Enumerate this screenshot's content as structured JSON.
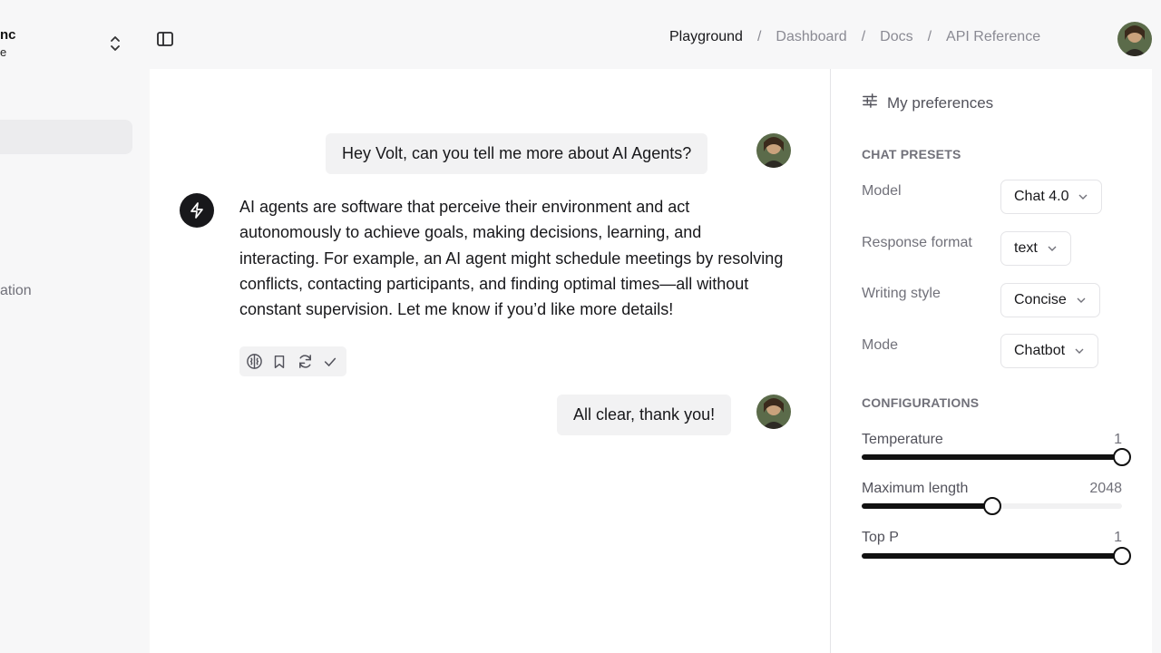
{
  "sidebar": {
    "org_name": "nc",
    "org_sub": "e",
    "items": [
      {
        "label": ""
      },
      {
        "label": "ation"
      }
    ]
  },
  "header": {
    "breadcrumb": [
      "Playground",
      "Dashboard",
      "Docs",
      "API Reference"
    ],
    "separator": "/"
  },
  "chat": {
    "messages": [
      {
        "role": "user",
        "text": "Hey Volt, can you tell me more about AI Agents?"
      },
      {
        "role": "assistant",
        "text": "AI agents are software that perceive their environment and act autonomously to achieve goals, making decisions, learning, and interacting. For example, an AI agent might schedule meetings by resolving conflicts, contacting participants, and finding optimal times—all without constant supervision. Let me know if you’d like more details!"
      },
      {
        "role": "user",
        "text": "All clear, thank you!"
      }
    ],
    "actions": [
      "brain-icon",
      "bookmark-icon",
      "refresh-icon",
      "check-icon"
    ]
  },
  "preferences": {
    "title": "My preferences",
    "presets_label": "CHAT PRESETS",
    "presets": [
      {
        "label": "Model",
        "value": "Chat 4.0"
      },
      {
        "label": "Response format",
        "value": "text"
      },
      {
        "label": "Writing style",
        "value": "Concise"
      },
      {
        "label": "Mode",
        "value": "Chatbot"
      }
    ],
    "config_label": "CONFIGURATIONS",
    "sliders": [
      {
        "label": "Temperature",
        "value": "1",
        "fraction": 1.0
      },
      {
        "label": "Maximum length",
        "value": "2048",
        "fraction": 0.5
      },
      {
        "label": "Top P",
        "value": "1",
        "fraction": 1.0
      }
    ]
  },
  "colors": {
    "accent": "#18181b",
    "muted": "#71717a",
    "surface": "#f2f2f3"
  }
}
